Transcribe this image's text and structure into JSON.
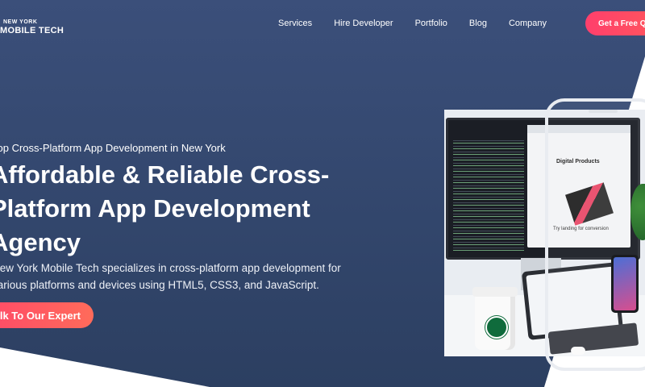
{
  "header": {
    "logo_small": "NEW YORK",
    "logo_big": "MOBILE TECH",
    "nav": [
      "Services",
      "Hire Developer",
      "Portfolio",
      "Blog",
      "Company"
    ],
    "quote_button": "Get a Free Quote"
  },
  "hero": {
    "eyebrow": "Top Cross-Platform App Development in New York",
    "headline": "Affordable & Reliable Cross-Platform App Development Agency",
    "description": "New York Mobile Tech specializes in cross-platform app development for various platforms and devices using HTML5, CSS3, and JavaScript.",
    "cta": "Talk To Our Expert"
  },
  "hero_image": {
    "browser_title": "Digital Products",
    "browser_subtitle": "Try landing for conversion"
  }
}
